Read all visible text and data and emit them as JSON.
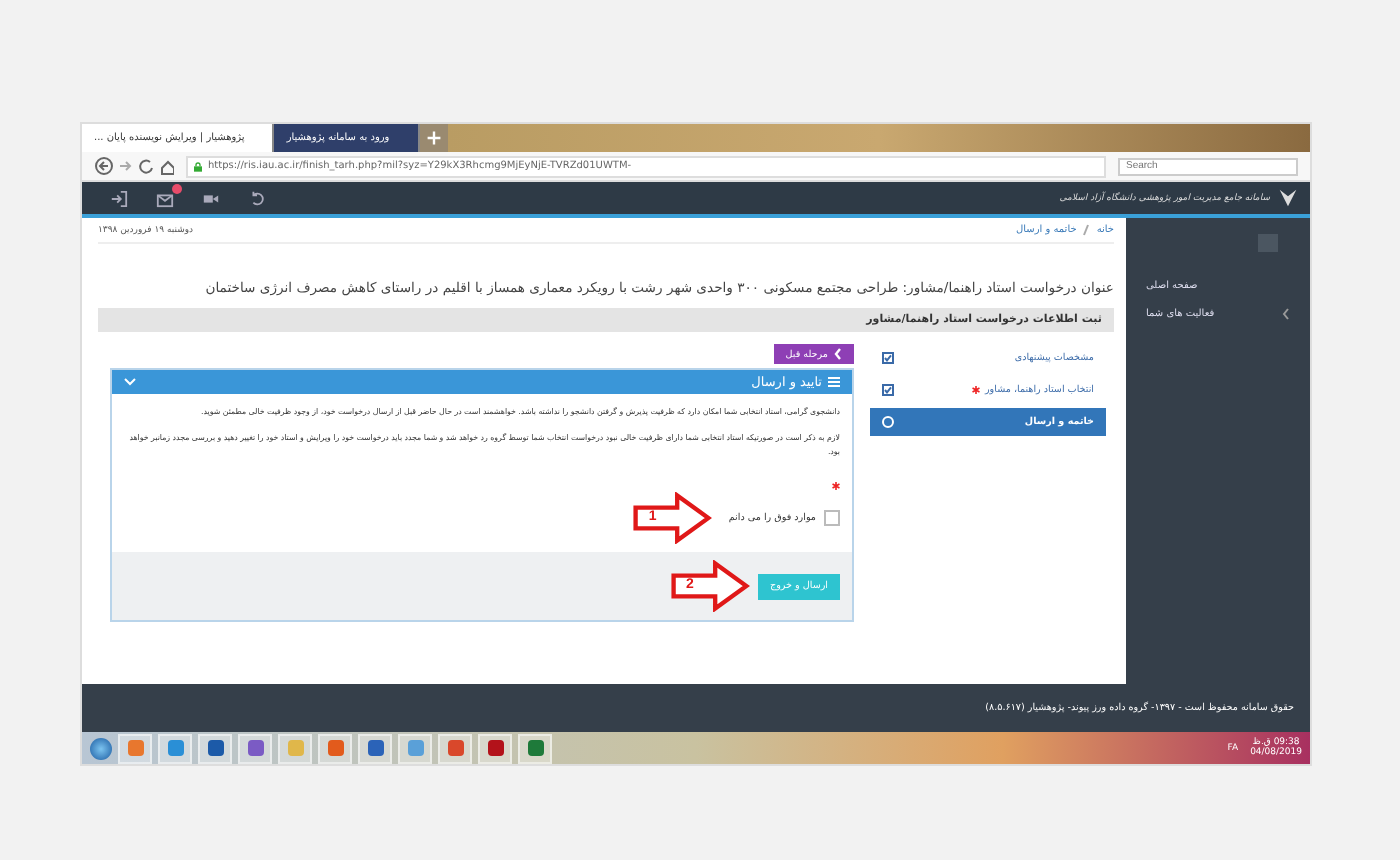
{
  "browser": {
    "tabs": [
      {
        "label": "ورود به سامانه پژوهشیار",
        "selected": false
      },
      {
        "label": "پژوهشیار | ویرایش نویسنده پایان ...",
        "selected": true
      }
    ],
    "url": "https://ris.iau.ac.ir/finish_tarh.php?mil?syz=Y29kX3Rhcmg9MjEyNjE-TVRZd01UWTM-",
    "search": {
      "placeholder": "Search"
    }
  },
  "app_bar": {
    "title": "سامانه جامع مدیریت امور پژوهشی دانشگاه آزاد اسلامی",
    "notification": true
  },
  "date": "دوشنبه ۱۹ فروردین ۱۳۹۸",
  "breadcrumb": [
    "خانه",
    "خاتمه و ارسال"
  ],
  "request_title": "عنوان درخواست استاد راهنما/مشاور: طراحی مجتمع مسکونی ۳۰۰ واحدی شهر رشت با رویکرد معماری همساز با اقلیم در راستای کاهش مصرف انرژی ساختمان",
  "panel": {
    "title": "ثبت اطلاعات درخواست استاد راهنما/مشاور",
    "steps": [
      {
        "label": "مشخصات پیشنهادی",
        "done": true,
        "required": false,
        "selected": false
      },
      {
        "label": "انتخاب استاد راهنما، مشاور",
        "done": true,
        "required": true,
        "selected": false
      },
      {
        "label": "خاتمه و ارسال",
        "done": false,
        "required": false,
        "selected": true
      }
    ],
    "back_button": "مرحله قبل",
    "box": {
      "title": "تایید و ارسال",
      "paragraphs": [
        "دانشجوی گرامی، استاد انتخابی شما امکان دارد که ظرفیت پذیرش و گرفتن دانشجو را نداشته باشد. خواهشمند است در حال حاضر قبل از ارسال درخواست خود، از وجود ظرفیت خالی مطمئن شوید.",
        "لازم به ذکر است در صورتیکه استاد انتخابی شما دارای ظرفیت خالی نبود درخواست انتخاب شما توسط گروه رد خواهد شد و شما مجدد باید درخواست خود را ویرایش و استاد خود را تغییر دهید و بررسی مجدد زمانبر خواهد بود."
      ],
      "checkbox": {
        "label": "موارد فوق را می دانم",
        "checked": false,
        "required": true
      },
      "submit_button": "ارسال و خروج"
    }
  },
  "annotations": [
    {
      "label": "1"
    },
    {
      "label": "2"
    }
  ],
  "sidebar": {
    "items": [
      {
        "label": "صفحه اصلی",
        "has_submenu": false
      },
      {
        "label": "فعالیت های شما",
        "has_submenu": true
      }
    ]
  },
  "footer": "حقوق سامانه محفوظ است - ۱۳۹۷- گروه داده ورز پیوند- پژوهشیار (۸.۵.۶۱۷)",
  "taskbar": {
    "language": "FA",
    "time": "09:38 ق.ظ",
    "date": "04/08/2019"
  }
}
